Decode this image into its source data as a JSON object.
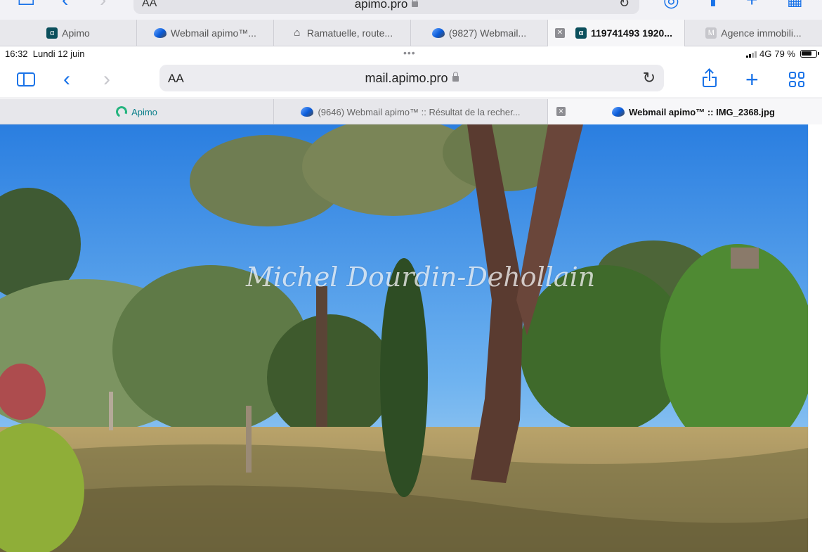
{
  "top_toolbar": {
    "aa": "AA",
    "url": "apimo.pro"
  },
  "top_tabs": [
    {
      "label": "Apimo",
      "icon": "apimo-favicon",
      "active": false
    },
    {
      "label": "Webmail apimo™...",
      "icon": "webmail-favicon",
      "active": false
    },
    {
      "label": "Ramatuelle, route...",
      "icon": "house-favicon",
      "active": false
    },
    {
      "label": "(9827) Webmail...",
      "icon": "webmail-favicon",
      "active": false
    },
    {
      "label": "119741493 1920...",
      "icon": "apimo-favicon",
      "active": true
    },
    {
      "label": "Agence immobili...",
      "icon": "letter-m-favicon",
      "active": false
    }
  ],
  "status_bar": {
    "time": "16:32",
    "date": "Lundi 12 juin",
    "network": "4G",
    "battery": "79 %",
    "battery_level": 0.79
  },
  "toolbar": {
    "aa": "AA",
    "url": "mail.apimo.pro"
  },
  "tabs": [
    {
      "label": "Apimo",
      "icon": "apimo-logo-icon",
      "active": false
    },
    {
      "label": "(9646) Webmail apimo™ :: Résultat de la recher...",
      "icon": "webmail-favicon",
      "active": false
    },
    {
      "label": "Webmail apimo™ :: IMG_2368.jpg",
      "icon": "webmail-favicon",
      "active": true
    }
  ],
  "image": {
    "description_icon": "garden-photo",
    "watermark": "Michel Dourdin-Dehollain"
  },
  "colors": {
    "accent": "#1a73e8",
    "apimo_teal": "#0b4f5c",
    "apimo_green": "#24b47e"
  }
}
